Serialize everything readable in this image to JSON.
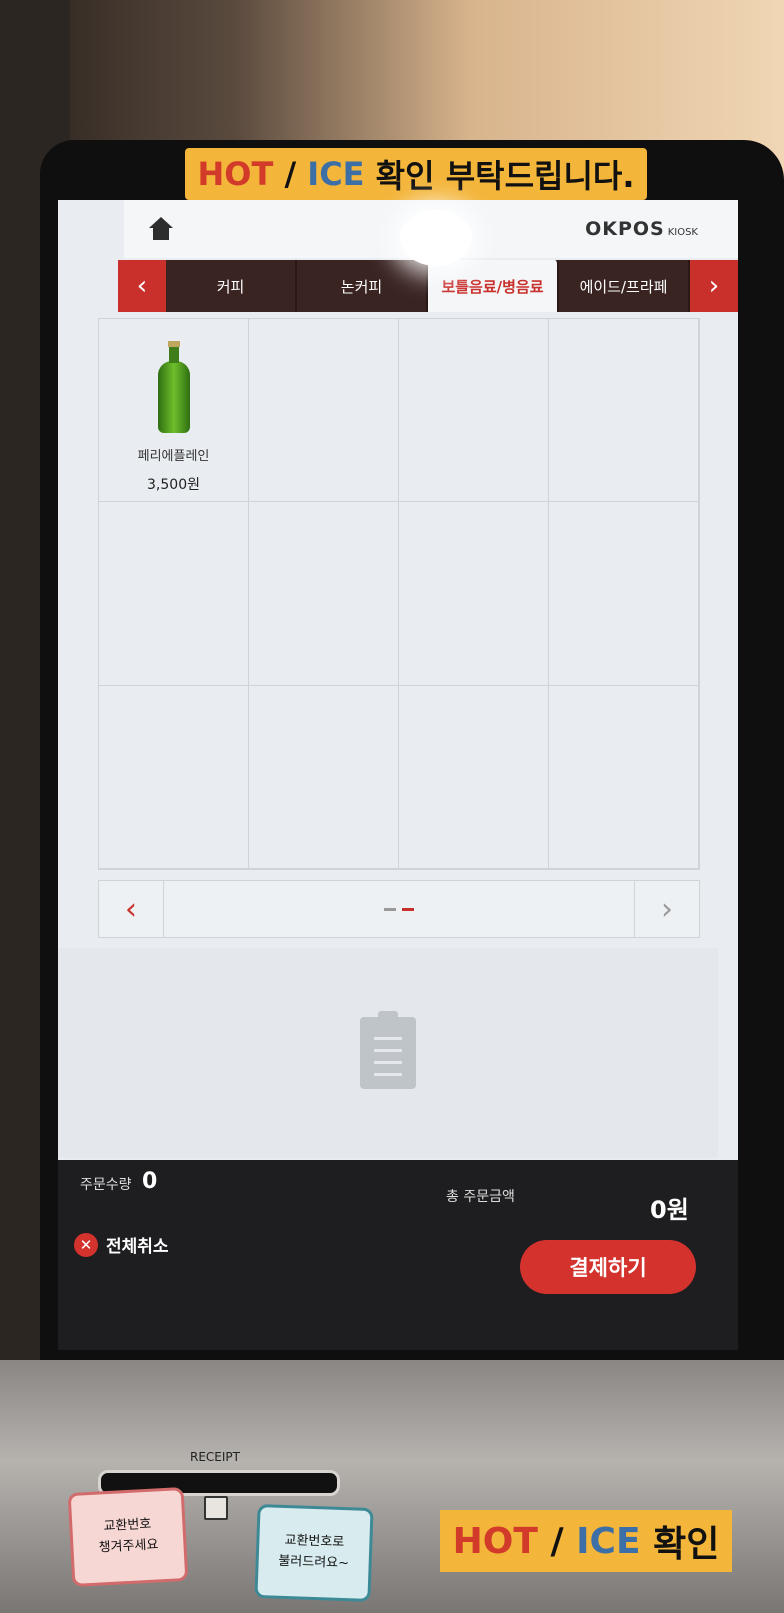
{
  "top_sticker": {
    "hot": "HOT",
    "sep": " / ",
    "ice": "ICE",
    "text": " 확인 부탁드립니다."
  },
  "header": {
    "logo": "OKPOS",
    "logo_sub": "KIOSK"
  },
  "tabs": [
    {
      "label": "커피",
      "active": false
    },
    {
      "label": "논커피",
      "active": false
    },
    {
      "label": "보틀음료/병음료",
      "active": true
    },
    {
      "label": "에이드/프라페",
      "active": false
    }
  ],
  "products": [
    {
      "name": "페리에플레인",
      "price": "3,500원"
    }
  ],
  "pager": {
    "pages": 2,
    "current": 2
  },
  "footer": {
    "qty_label": "주문수량",
    "qty_value": "0",
    "total_label": "총 주문금액",
    "total_value": "0원",
    "cancel_label": "전체취소",
    "pay_label": "결제하기"
  },
  "base": {
    "receipt_label": "RECEIPT",
    "note_left": "교환번호\n챙겨주세요",
    "note_right": "교환번호로\n불러드려요~",
    "sticker": {
      "hot": "HOT",
      "sep": " / ",
      "ice": "ICE",
      "text": " 확인"
    }
  },
  "colors": {
    "accent": "#d3322d",
    "tab_bar": "#3a2422",
    "sticker": "#f3b53a"
  }
}
